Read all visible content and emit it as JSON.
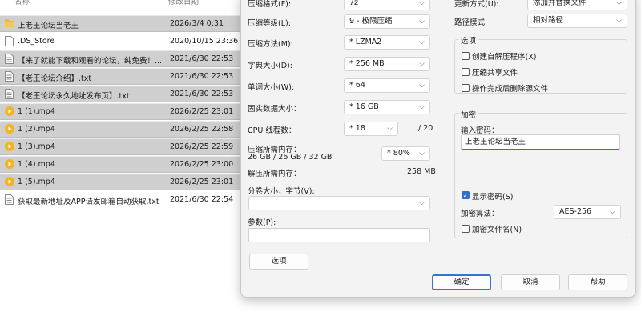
{
  "explorer": {
    "columns": {
      "name": "名称",
      "date": "修改日期"
    },
    "files": [
      {
        "name": "上老王论坛当老王",
        "date": "2026/3/4 0:31",
        "icon": "folder-icon"
      },
      {
        "name": ".DS_Store",
        "date": "2020/10/15 23:36",
        "icon": "file-icon"
      },
      {
        "name": "【来了就能下载和观看的论坛，纯免费！...",
        "date": "2021/6/30 22:53",
        "icon": "text-file-icon"
      },
      {
        "name": "【老王论坛介绍】.txt",
        "date": "2021/6/30 22:53",
        "icon": "text-file-icon"
      },
      {
        "name": "【老王论坛永久地址发布页】.txt",
        "date": "2021/6/30 22:53",
        "icon": "text-file-icon"
      },
      {
        "name": "1 (1).mp4",
        "date": "2026/2/25 23:01",
        "icon": "video-file-icon"
      },
      {
        "name": "1 (2).mp4",
        "date": "2026/2/25 22:58",
        "icon": "video-file-icon"
      },
      {
        "name": "1 (3).mp4",
        "date": "2026/2/25 22:59",
        "icon": "video-file-icon"
      },
      {
        "name": "1 (4).mp4",
        "date": "2026/2/25 23:00",
        "icon": "video-file-icon"
      },
      {
        "name": "1 (5).mp4",
        "date": "2026/2/25 23:01",
        "icon": "video-file-icon"
      },
      {
        "name": "获取最新地址及APP请发邮箱自动获取.txt",
        "date": "2021/6/30 22:54",
        "icon": "text-file-icon"
      }
    ]
  },
  "dialog": {
    "format_label": "压缩格式(F):",
    "format_value": "7z",
    "level_label": "压缩等级(L):",
    "level_value": "9 - 极限压缩",
    "method_label": "压缩方法(M):",
    "method_value": "* LZMA2",
    "dict_label": "字典大小(D):",
    "dict_value": "* 256 MB",
    "word_label": "单词大小(W):",
    "word_value": "* 64",
    "solid_label": "固实数据大小：",
    "solid_value": "* 16 GB",
    "threads_label": "CPU 线程数：",
    "threads_value": "* 18",
    "threads_total": "/ 20",
    "mem_label": "压缩所需内存：",
    "mem_detail": "26 GB / 26 GB / 32 GB",
    "mem_percent": "* 80%",
    "decomp_label": "解压所需内存：",
    "decomp_value": "258 MB",
    "volume_label": "分卷大小，字节(V):",
    "volume_value": "",
    "params_label": "参数(P):",
    "params_value": "",
    "options_button": "选项",
    "update_label": "更新方式(U):",
    "update_value": "添加并替换文件",
    "path_label": "路径模式",
    "path_value": "相对路径",
    "options_group": "选项",
    "opt_sfx": "创建自解压程序(X)",
    "opt_shared": "压缩共享文件",
    "opt_delete": "操作完成后删除源文件",
    "encrypt_group": "加密",
    "password_label": "输入密码：",
    "password_value": "上老王论坛当老王",
    "show_password": "显示密码(S)",
    "enc_method_label": "加密算法：",
    "enc_method_value": "AES-256",
    "encrypt_names": "加密文件名(N)",
    "ok": "确定",
    "cancel": "取消",
    "help": "帮助"
  }
}
